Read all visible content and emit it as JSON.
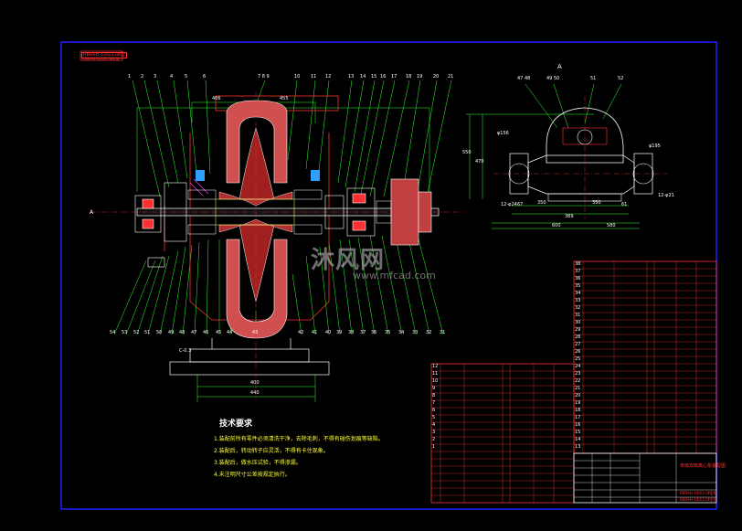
{
  "drawing": {
    "stamp_line1": "RBR6H-100/3.0Ⅱ型",
    "stamp_line2": "RBR6H-100/3.0Ⅱ型泵",
    "title": "单级双吸离心泵装配图",
    "title_sub1": "RBR6H-100/3.0Ⅱ型泵",
    "title_sub2": "RBR6H-100/3.0Ⅱ型泵"
  },
  "tech_notes": {
    "heading": "技术要求",
    "items": [
      "1.装配前所有零件必须清洗干净，去除毛刺，不得有碰伤划痕等缺陷。",
      "2.装配后，转动转子应灵活，不得有卡住现象。",
      "3.装配后，做水压试验，不得渗漏。",
      "4.未注明尺寸公差按规定执行。"
    ]
  },
  "dimensions": {
    "d_top_left": "466",
    "d_top_right": "455",
    "d_bottom1": "400",
    "d_bottom2": "440",
    "d_side_550": "550",
    "d_side_470": "470",
    "d_350a": "350",
    "d_350b": "350",
    "d_600": "600",
    "d_580": "580",
    "d_389": "389",
    "d_67": "67",
    "d_61": "61",
    "d_phi156": "φ156",
    "d_phi195": "φ195",
    "d_bolt_left": "12-φ24",
    "d_bolt_right": "12-φ21",
    "d_c": "C-0.3",
    "view_label": "A",
    "arrow_a": "A"
  },
  "callouts_top": [
    "1",
    "2",
    "3",
    "4",
    "5",
    "6",
    "7 8 9",
    "10",
    "11",
    "12",
    "13",
    "14",
    "15",
    "16",
    "17",
    "18",
    "19",
    "20",
    "21"
  ],
  "callouts_bottom": [
    "54",
    "53",
    "52",
    "51",
    "50",
    "49",
    "48",
    "47",
    "46",
    "45",
    "44",
    "43",
    "42",
    "41",
    "40",
    "39",
    "38",
    "37",
    "36",
    "35",
    "34",
    "33",
    "32",
    "31",
    "30",
    "29",
    "28",
    "27",
    "26",
    "25",
    "24",
    "23",
    "22"
  ],
  "callouts_side": [
    "47 48",
    "49 50",
    "51",
    "52"
  ],
  "watermark": {
    "main": "沐风网",
    "sub": "www.mfcad.com"
  },
  "colors": {
    "border": "#2020ff",
    "frame": "#ffffff",
    "red": "#ff3030",
    "yellow": "#ffff40",
    "green": "#30ff30",
    "magenta": "#ff40ff",
    "section": "#ff5050"
  },
  "bom_right_rows": [
    "38",
    "37",
    "36",
    "35",
    "34",
    "33",
    "32",
    "31",
    "30",
    "29",
    "28",
    "27",
    "26",
    "25",
    "24",
    "23",
    "22",
    "21",
    "20",
    "19",
    "18",
    "17",
    "16",
    "15",
    "14",
    "13",
    "12"
  ],
  "bom_left_rows": [
    "12",
    "11",
    "10",
    "9",
    "8",
    "7",
    "6",
    "5",
    "4",
    "3",
    "2",
    "1"
  ]
}
